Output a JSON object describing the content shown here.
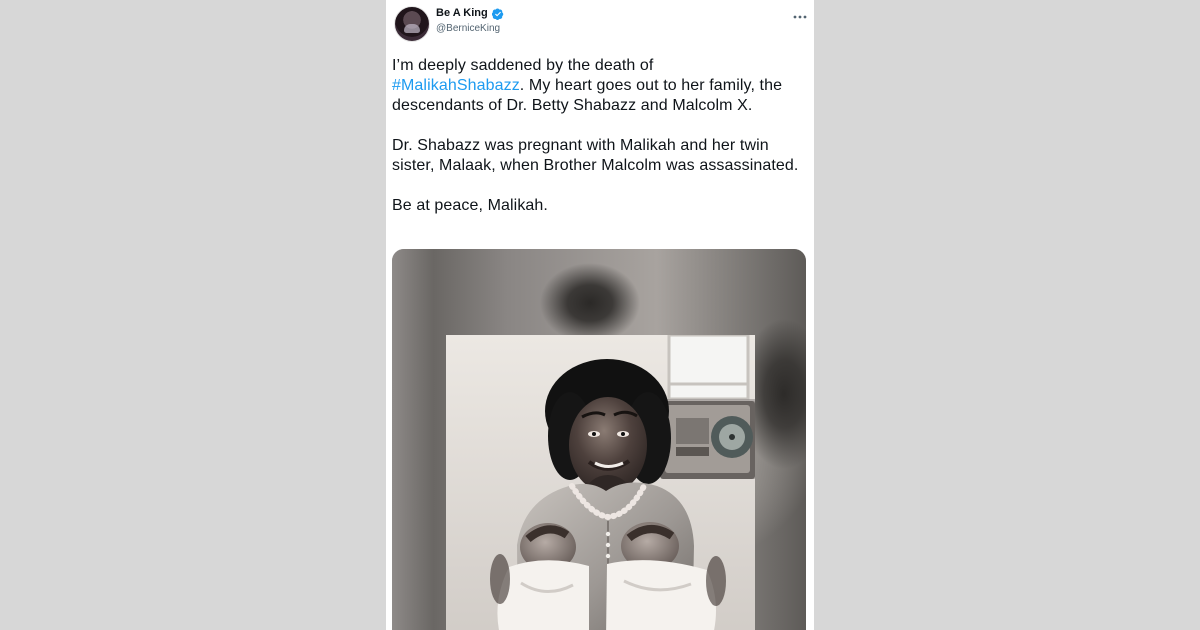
{
  "tweet": {
    "display_name": "Be A King",
    "handle": "@BerniceKing",
    "verified": true,
    "body": {
      "line1_before": "I’m deeply saddened by the death of",
      "hashtag": "#MalikahShabazz",
      "line1_after": ". My heart goes out to her family, the descendants of Dr. Betty Shabazz and Malcolm X.",
      "paragraph2": "Dr. Shabazz was pregnant with Malikah and her twin sister, Malaak, when Brother Malcolm was assassinated.",
      "paragraph3": "Be at peace, Malikah."
    },
    "icons": {
      "avatar": "profile-avatar",
      "verified": "verified-badge-icon",
      "more": "more-options-icon"
    },
    "colors": {
      "page_background": "#d7d7d7",
      "card_background": "#ffffff",
      "text": "#0f1419",
      "muted": "#536471",
      "link": "#1d9bf0",
      "verified": "#1d9bf0"
    }
  }
}
